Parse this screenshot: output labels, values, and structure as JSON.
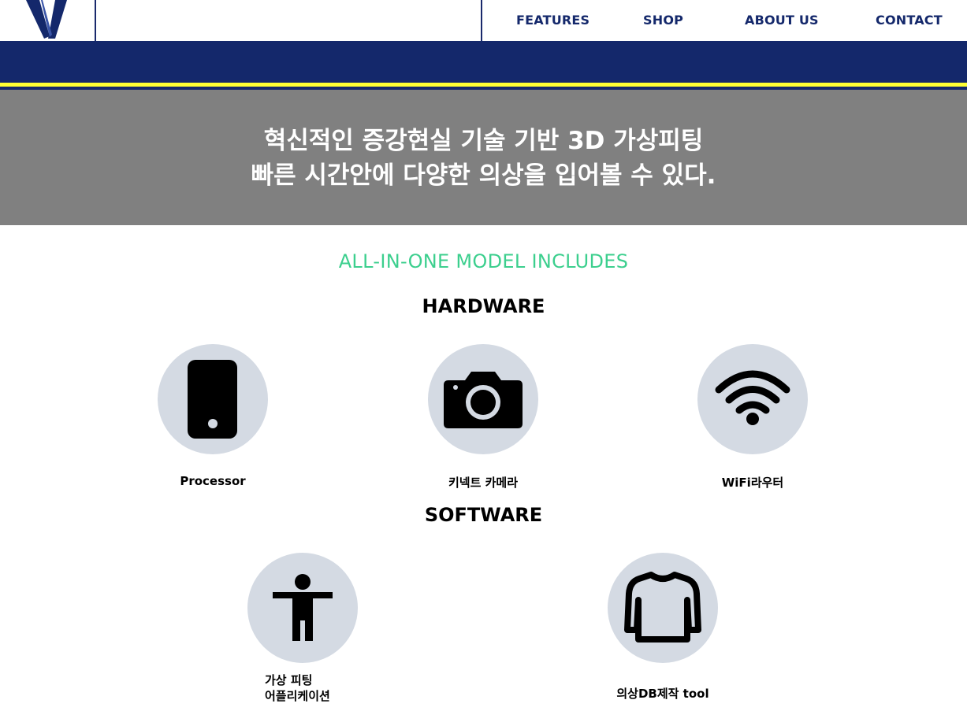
{
  "brand": {
    "logo_icon": "v-logo-icon",
    "colors": {
      "navy": "#14286b",
      "accent_yellow": "#ffff33",
      "hero_gray": "#808080",
      "green": "#3ccf8e",
      "circle_bg": "#d4dae3"
    }
  },
  "nav": {
    "items": [
      {
        "label": "FEATURES"
      },
      {
        "label": "SHOP"
      },
      {
        "label": "ABOUT US"
      },
      {
        "label": "CONTACT"
      }
    ]
  },
  "hero": {
    "line1": "혁신적인 증강현실 기술 기반 3D 가상피팅",
    "line2": "빠른 시간안에 다양한 의상을 입어볼 수 있다."
  },
  "includes": {
    "title": "ALL-IN-ONE MODEL INCLUDES",
    "hardware": {
      "heading": "HARDWARE",
      "items": [
        {
          "label": "Processor",
          "icon": "smartphone-icon"
        },
        {
          "label": "키넥트 카메라",
          "icon": "camera-icon"
        },
        {
          "label": "WiFi라우터",
          "icon": "wifi-icon"
        }
      ]
    },
    "software": {
      "heading": "SOFTWARE",
      "items": [
        {
          "label_line1": "가상 피팅",
          "label_line2": "어플리케이션",
          "icon": "person-icon"
        },
        {
          "label": "의상DB제작 tool",
          "icon": "sweater-icon"
        }
      ]
    }
  }
}
